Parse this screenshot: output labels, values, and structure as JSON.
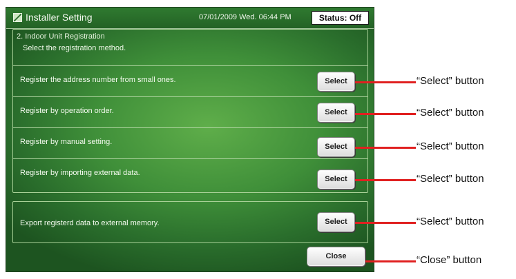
{
  "window": {
    "title": "Installer Setting",
    "datetime": "07/01/2009 Wed. 06:44 PM",
    "status": "Status: Off"
  },
  "section": {
    "title": "2. Indoor Unit Registration",
    "subtitle": "Select the registration method."
  },
  "rows": [
    {
      "label": "Register the address number from small ones.",
      "button": "Select"
    },
    {
      "label": "Register by operation order.",
      "button": "Select"
    },
    {
      "label": "Register by manual setting.",
      "button": "Select"
    },
    {
      "label": "Register by importing external data.",
      "button": "Select"
    }
  ],
  "export_row": {
    "label": "Export registerd data to external memory.",
    "button": "Select"
  },
  "close_button": "Close",
  "callouts": {
    "select": "“Select” button",
    "close": "“Close” button"
  },
  "colors": {
    "screen_green": "#3f8f39",
    "callout_red": "#e02020"
  }
}
